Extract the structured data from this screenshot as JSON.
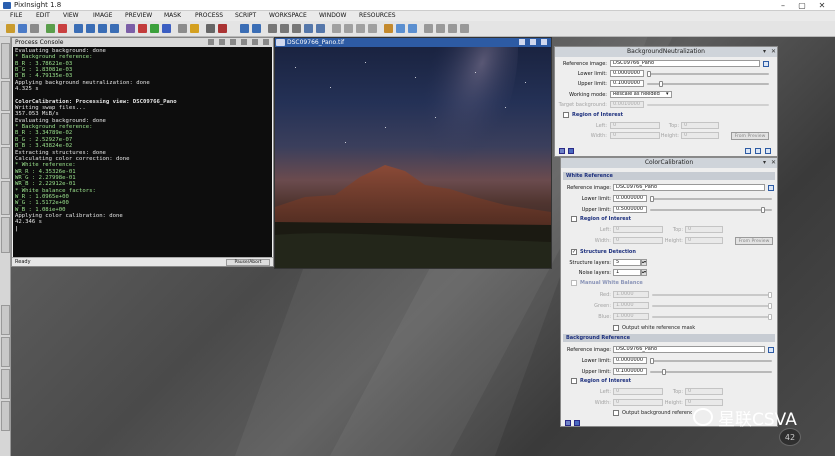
{
  "app": {
    "title": "PixInsight 1.8"
  },
  "menu": [
    "FILE",
    "EDIT",
    "VIEW",
    "IMAGE",
    "PREVIEW",
    "MASK",
    "PROCESS",
    "SCRIPT",
    "WORKSPACE",
    "WINDOW",
    "RESOURCES"
  ],
  "console": {
    "title": "Process Console",
    "lines": [
      {
        "t": "Evaluating background: done",
        "c": ""
      },
      {
        "t": "* Background reference:",
        "c": "ok"
      },
      {
        "t": "B_R : 3.78621e-03",
        "c": "ok"
      },
      {
        "t": "B_G : 1.83081e-03",
        "c": "ok"
      },
      {
        "t": "B_B : 4.79135e-03",
        "c": "ok"
      },
      {
        "t": "Applying background neutralization: done",
        "c": ""
      },
      {
        "t": "4.325 s",
        "c": ""
      },
      {
        "t": "",
        "c": ""
      },
      {
        "t": "ColorCalibration: Processing view: DSC09766_Pano",
        "c": "bold"
      },
      {
        "t": "Writing swap files...",
        "c": ""
      },
      {
        "t": "357.053 MiB/s",
        "c": ""
      },
      {
        "t": "Evaluating background: done",
        "c": ""
      },
      {
        "t": "* Background reference:",
        "c": "ok"
      },
      {
        "t": "B_R : 3.34789e-02",
        "c": "ok"
      },
      {
        "t": "B_G : 2.52927e-07",
        "c": "ok"
      },
      {
        "t": "B_B : 3.43824e-02",
        "c": "ok"
      },
      {
        "t": "Extracting structures: done",
        "c": ""
      },
      {
        "t": "Calculating color correction: done",
        "c": ""
      },
      {
        "t": "* White reference:",
        "c": "ok"
      },
      {
        "t": "WR_R : 4.35326e-01",
        "c": "ok"
      },
      {
        "t": "WR_G : 2.27998e-01",
        "c": "ok"
      },
      {
        "t": "WR_B : 2.22912e-01",
        "c": "ok"
      },
      {
        "t": "* White balance factors:",
        "c": "ok"
      },
      {
        "t": "W_R : 1.0965e+00",
        "c": "ok"
      },
      {
        "t": "W_G : 1.5172e+00",
        "c": "ok"
      },
      {
        "t": "W_B : 1.08ie+00",
        "c": "ok"
      },
      {
        "t": "Applying color calibration: done",
        "c": ""
      },
      {
        "t": "42.346 s",
        "c": ""
      },
      {
        "t": "|",
        "c": "bold"
      }
    ],
    "status": "Ready",
    "pause_label": "Pause/Abort"
  },
  "image_window": {
    "title": "DSC09766_Pano.tif"
  },
  "bg_neutralization": {
    "title": "BackgroundNeutralization",
    "reference_image_label": "Reference image:",
    "reference_image_value": "DSC09766_Pano",
    "lower_limit_label": "Lower limit:",
    "lower_limit_value": "0.0000000",
    "upper_limit_label": "Upper limit:",
    "upper_limit_value": "0.1000000",
    "working_mode_label": "Working mode:",
    "working_mode_value": "Rescale as needed",
    "target_bg_label": "Target background:",
    "target_bg_value": "0.0010000",
    "roi_label": "Region of Interest",
    "left_label": "Left:",
    "left_value": "0",
    "top_label": "Top:",
    "top_value": "0",
    "width_label": "Width:",
    "width_value": "0",
    "height_label": "Height:",
    "height_value": "0",
    "from_preview": "From Preview"
  },
  "color_calibration": {
    "title": "ColorCalibration",
    "white_reference_title": "White Reference",
    "reference_image_label": "Reference image:",
    "reference_image_value": "DSC09766_Pano",
    "lower_limit_label": "Lower limit:",
    "lower_limit_value": "0.0000000",
    "upper_limit_label": "Upper limit:",
    "upper_limit_value": "0.5000000",
    "roi_label": "Region of Interest",
    "left_label": "Left:",
    "left_value": "0",
    "top_label": "Top:",
    "top_value": "0",
    "width_label": "Width:",
    "width_value": "0",
    "height_label": "Height:",
    "height_value": "0",
    "from_preview": "From Preview",
    "structure_detection_label": "Structure Detection",
    "structure_layers_label": "Structure layers:",
    "structure_layers_value": "5",
    "noise_layers_label": "Noise layers:",
    "noise_layers_value": "1",
    "manual_wb_label": "Manual White Balance",
    "red_label": "Red:",
    "red_value": "1.0000",
    "green_label": "Green:",
    "green_value": "1.0000",
    "blue_label": "Blue:",
    "blue_value": "1.0000",
    "output_mask_label": "Output white reference mask",
    "background_reference_title": "Background Reference",
    "bg_reference_image_value": "DSC09766_Pano",
    "bg_lower_limit_value": "0.0000000",
    "bg_upper_limit_value": "0.1000000",
    "output_bg_mask_label": "Output background reference mask"
  },
  "watermark": {
    "text": "星联CSVA"
  },
  "badge": {
    "text": "42"
  }
}
